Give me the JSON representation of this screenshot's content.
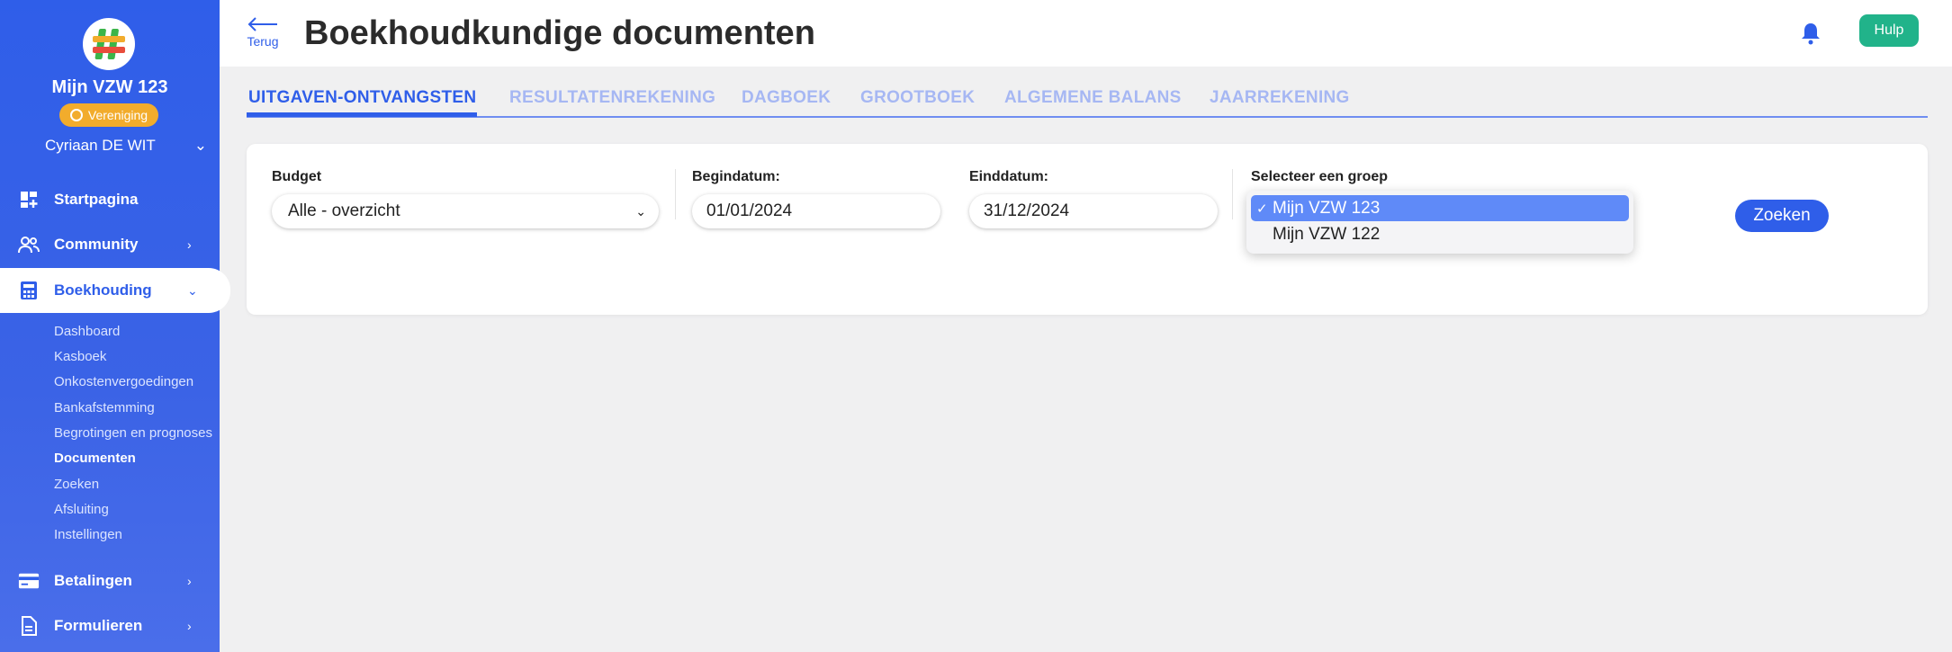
{
  "sidebar": {
    "org_name": "Mijn VZW 123",
    "badge": "Vereniging",
    "user": "Cyriaan DE WIT",
    "nav": {
      "home": "Startpagina",
      "community": "Community",
      "accounting": "Boekhouding",
      "payments": "Betalingen",
      "forms": "Formulieren"
    },
    "sub_items": [
      "Dashboard",
      "Kasboek",
      "Onkostenvergoedingen",
      "Bankafstemming",
      "Begrotingen en prognoses",
      "Documenten",
      "Zoeken",
      "Afsluiting",
      "Instellingen"
    ]
  },
  "header": {
    "back_label": "Terug",
    "title": "Boekhoudkundige documenten",
    "help_label": "Hulp"
  },
  "tabs": [
    "UITGAVEN-ONTVANGSTEN",
    "RESULTATENREKENING",
    "DAGBOEK",
    "GROOTBOEK",
    "ALGEMENE BALANS",
    "JAARREKENING"
  ],
  "filters": {
    "budget_label": "Budget",
    "budget_value": "Alle - overzicht",
    "start_label": "Begindatum:",
    "start_value": "01/01/2024",
    "end_label": "Einddatum:",
    "end_value": "31/12/2024",
    "group_label": "Selecteer een groep",
    "group_options": [
      "Mijn VZW 123",
      "Mijn VZW 122"
    ],
    "search_label": "Zoeken"
  },
  "colors": {
    "primary": "#2f5ee9",
    "help": "#21b38a",
    "badge": "#f2ac2c"
  }
}
